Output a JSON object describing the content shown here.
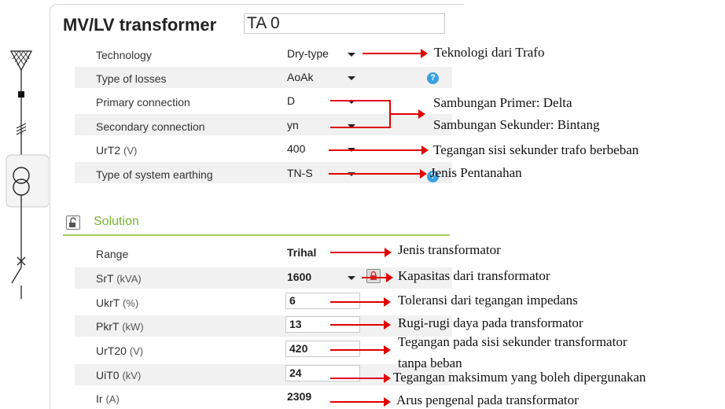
{
  "header": {
    "title": "MV/LV transformer",
    "name_value": "TA 0"
  },
  "params": [
    {
      "label": "Technology",
      "unit": "",
      "value": "Dry-type"
    },
    {
      "label": "Type of losses",
      "unit": "",
      "value": "AoAk"
    },
    {
      "label": "Primary connection",
      "unit": "",
      "value": "D"
    },
    {
      "label": "Secondary connection",
      "unit": "",
      "value": "yn"
    },
    {
      "label": "UrT2",
      "unit": "(V)",
      "value": "400"
    },
    {
      "label": "Type of system earthing",
      "unit": "",
      "value": "TN-S"
    }
  ],
  "solution": {
    "title": "Solution",
    "rows": [
      {
        "label": "Range",
        "unit": "",
        "value": "Trihal"
      },
      {
        "label": "SrT",
        "unit": "(kVA)",
        "value": "1600"
      },
      {
        "label": "UkrT",
        "unit": "(%)",
        "value": "6"
      },
      {
        "label": "PkrT",
        "unit": "(kW)",
        "value": "13"
      },
      {
        "label": "UrT20",
        "unit": "(V)",
        "value": "420"
      },
      {
        "label": "UiT0",
        "unit": "(kV)",
        "value": "24"
      },
      {
        "label": "Ir",
        "unit": "(A)",
        "value": "2309"
      }
    ]
  },
  "annotations": [
    "Teknologi dari Trafo",
    "Sambungan Primer: Delta",
    "Sambungan Sekunder: Bintang",
    "Tegangan sisi sekunder trafo berbeban",
    "Jenis Pentanahan",
    "Jenis transformator",
    "Kapasitas dari transformator",
    "Toleransi dari tegangan impedans",
    "Rugi-rugi daya pada transformator",
    "Tegangan pada sisi sekunder transformator",
    "tanpa beban",
    "Tegangan maksimum yang boleh dipergunakan",
    "Arus pengenal pada transformator"
  ],
  "icons": {
    "help": "?",
    "lock": "lock-icon",
    "unlock": "unlock-icon"
  },
  "colors": {
    "accent_green": "#7ab530",
    "help_blue": "#3aa0e0",
    "arrow_red": "#e00000"
  }
}
